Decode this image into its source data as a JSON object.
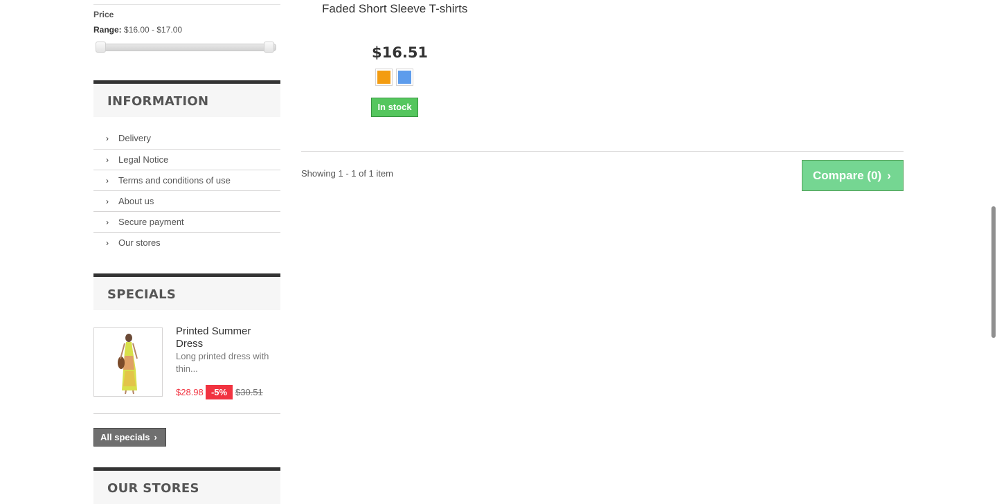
{
  "filter": {
    "title": "Price",
    "range_label": "Range:",
    "range_value": "$16.00 - $17.00",
    "slider_min": 16.0,
    "slider_max": 17.0
  },
  "information": {
    "title": "INFORMATION",
    "items": [
      {
        "label": "Delivery"
      },
      {
        "label": "Legal Notice"
      },
      {
        "label": "Terms and conditions of use"
      },
      {
        "label": "About us"
      },
      {
        "label": "Secure payment"
      },
      {
        "label": "Our stores"
      }
    ]
  },
  "specials": {
    "title": "SPECIALS",
    "product": {
      "name": "Printed Summer Dress",
      "description": "Long printed dress with thin...",
      "price": "$28.98",
      "discount": "-5%",
      "old_price": "$30.51",
      "image_icon": "dress-thumbnail"
    },
    "all_button": "All specials"
  },
  "next_block": {
    "title": "OUR STORES"
  },
  "product": {
    "name": "Faded Short Sleeve T-shirts",
    "price": "$16.51",
    "colors": [
      "#f39c11",
      "#5d9cec"
    ],
    "availability": "In stock"
  },
  "pagination": {
    "showing": "Showing 1 - 1 of 1 item"
  },
  "compare": {
    "label": "Compare (0)"
  },
  "icons": {
    "chevron": "chevron-right-icon"
  }
}
